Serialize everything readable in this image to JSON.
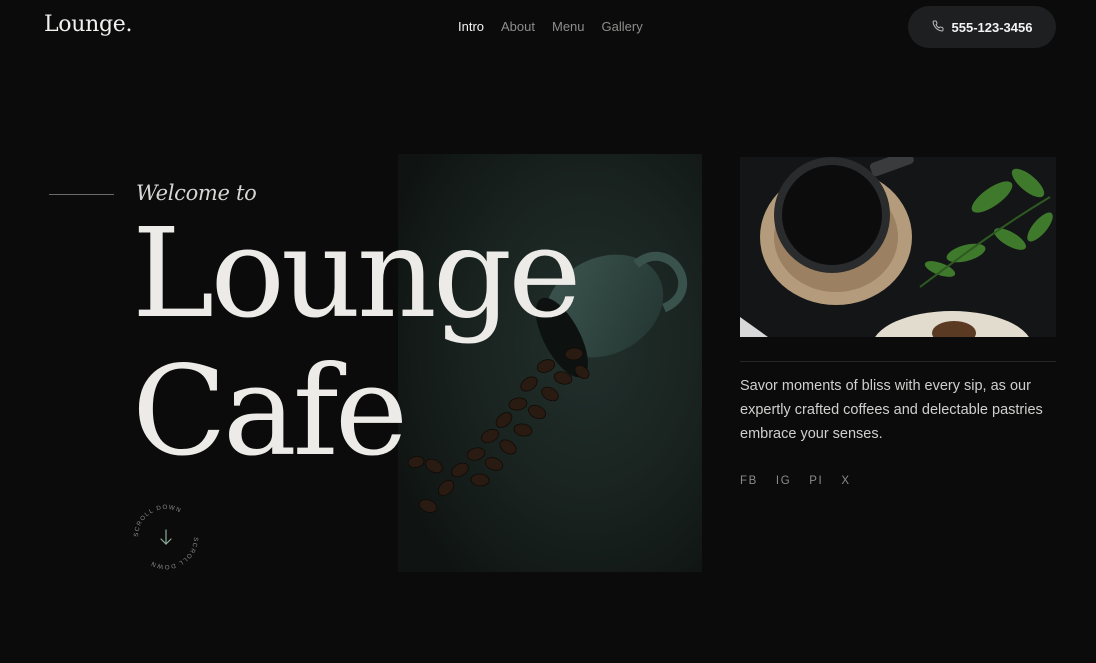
{
  "brand": {
    "logo": "Lounge."
  },
  "nav": {
    "items": [
      {
        "label": "Intro",
        "active": true
      },
      {
        "label": "About"
      },
      {
        "label": "Menu"
      },
      {
        "label": "Gallery"
      }
    ]
  },
  "header": {
    "phone": "555-123-3456",
    "phone_icon": "phone-icon"
  },
  "hero": {
    "welcome": "Welcome to",
    "title_line1": "Lounge",
    "title_line2": "Cafe",
    "scroll_label": "SCROLL DOWN",
    "scroll_icon": "arrow-down-icon"
  },
  "sidebar": {
    "description": "Savor moments of bliss with every sip, as our expertly crafted coffees and delectable pastries embrace your senses.",
    "socials": [
      {
        "label": "FB"
      },
      {
        "label": "IG"
      },
      {
        "label": "PI"
      },
      {
        "label": "X"
      }
    ]
  },
  "colors": {
    "background": "#0b0b0c",
    "accent_green": "#8fae9b",
    "pill": "#1e1f21"
  }
}
